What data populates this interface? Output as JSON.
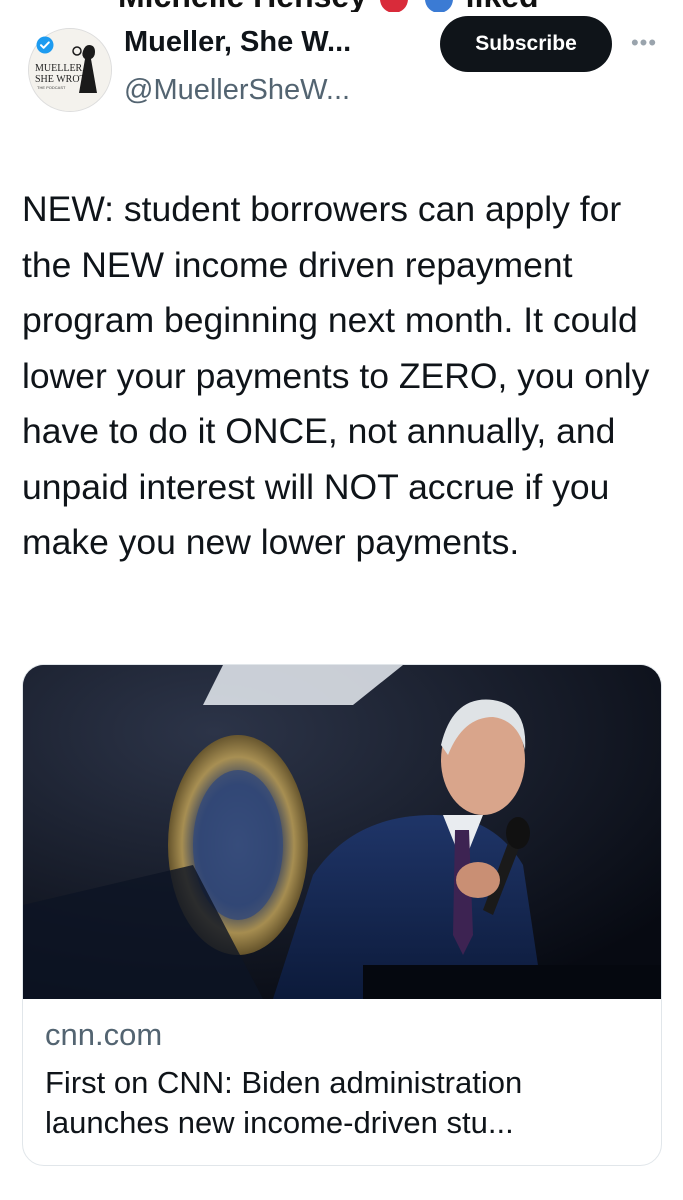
{
  "header": {
    "liked_by_cutoff": "Michelle Hensey",
    "liked_by_suffix": "liked"
  },
  "author": {
    "display_name": "Mueller, She W...",
    "handle": "@MuellerSheW...",
    "avatar_icon": "podcast-logo-icon",
    "avatar_text": "MUELLER, SHE WROTE THE PODCAST",
    "verified_color": "#1d9bf0"
  },
  "actions": {
    "subscribe_label": "Subscribe",
    "more_icon": "more-options-icon"
  },
  "tweet": {
    "text": "NEW: student borrowers can apply for the NEW income driven repayment program beginning next month. It could lower your payments to ZERO, you only have to do it ONCE, not annually, and unpaid interest will NOT accrue if you make you new lower payments."
  },
  "link_card": {
    "domain": "cnn.com",
    "title": "First on CNN: Biden administration launches new income-driven stu...",
    "image_icon": "speaker-at-podium-photo"
  }
}
